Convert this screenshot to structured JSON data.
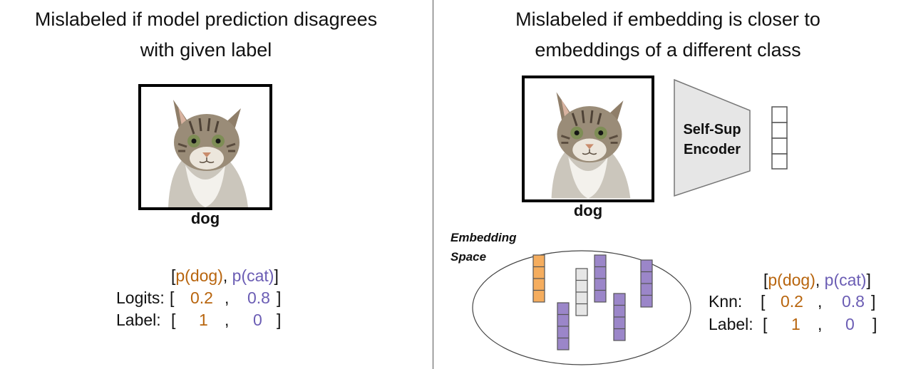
{
  "left": {
    "title_line1": "Mislabeled if model prediction disagrees",
    "title_line2": "with given label",
    "image_caption": "dog",
    "header_open": "[",
    "header_pdog": "p(dog)",
    "header_comma": ", ",
    "header_pcat": "p(cat)",
    "header_close": "]",
    "logits_label": "Logits:",
    "logits_open": "[",
    "logits_v1": "0.2",
    "logits_comma": ",",
    "logits_v2": "0.8",
    "logits_close": "]",
    "label_label": "Label:",
    "label_open": "[",
    "label_v1": "1",
    "label_comma": ",",
    "label_v2": "0",
    "label_close": "]"
  },
  "right": {
    "title_line1": "Mislabeled if embedding is closer to",
    "title_line2": "embeddings of a different class",
    "image_caption": "dog",
    "encoder_line1": "Self-Sup",
    "encoder_line2": "Encoder",
    "embedding_line1": "Embedding",
    "embedding_line2": "Space",
    "header_open": "[",
    "header_pdog": "p(dog)",
    "header_comma": ", ",
    "header_pcat": "p(cat)",
    "header_close": "]",
    "knn_label": "Knn:",
    "knn_open": "[",
    "knn_v1": "0.2",
    "knn_comma": ",",
    "knn_v2": "0.8",
    "knn_close": "]",
    "label_label": "Label:",
    "label_open": "[",
    "label_v1": "1",
    "label_comma": ",",
    "label_v2": "0",
    "label_close": "]"
  },
  "colors": {
    "dog_class": "#f5ad5e",
    "cat_class": "#9b86c9",
    "query": "#e6e6e6",
    "orange_text": "#b8650e",
    "purple_text": "#6b5db4"
  },
  "icons": [
    "cat-photo-icon",
    "encoder-trapezoid-icon",
    "embedding-vector-icon"
  ]
}
